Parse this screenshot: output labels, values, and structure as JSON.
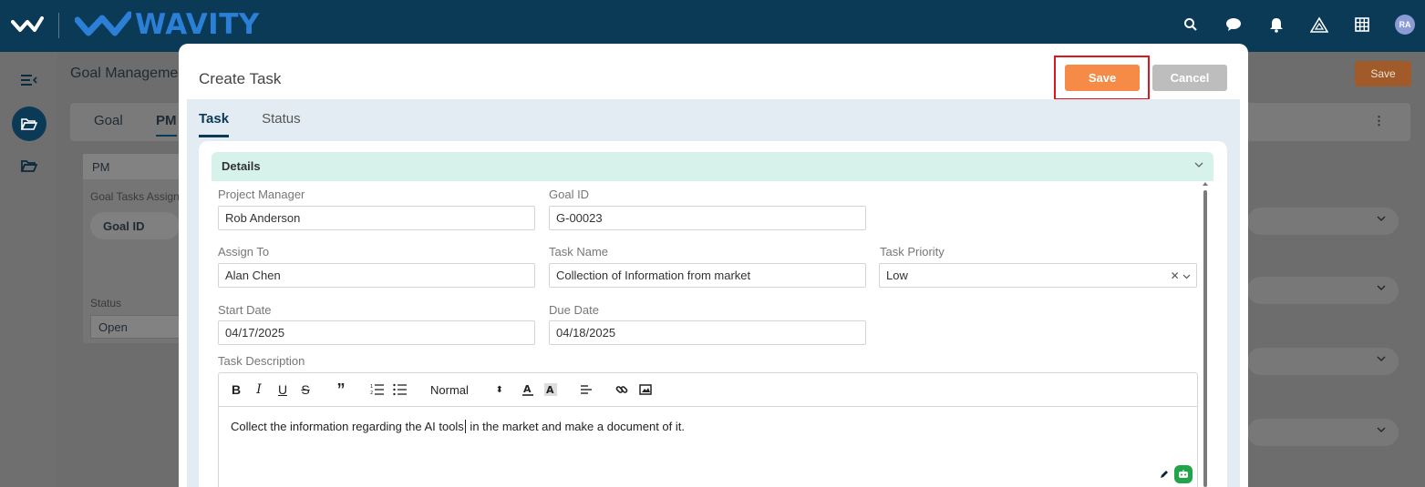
{
  "app": {
    "brand": "WAVITY",
    "avatar_initials": "RA",
    "top_icons": [
      "search-icon",
      "chat-icon",
      "bell-icon",
      "warning-icon",
      "grid-icon"
    ]
  },
  "background": {
    "breadcrumb": "Goal Managemen",
    "save_label": "Save",
    "tabs": [
      "Goal",
      "PM"
    ],
    "panel": {
      "header": "PM",
      "assign_label": "Goal Tasks Assign",
      "goal_id_pill": "Goal ID",
      "status_label": "Status",
      "status_value": "Open"
    }
  },
  "modal": {
    "title": "Create Task",
    "save_label": "Save",
    "cancel_label": "Cancel",
    "tabs": [
      {
        "label": "Task",
        "active": true
      },
      {
        "label": "Status",
        "active": false
      }
    ],
    "section_title": "Details",
    "fields": {
      "project_manager": {
        "label": "Project Manager",
        "value": "Rob Anderson"
      },
      "goal_id": {
        "label": "Goal ID",
        "value": "G-00023"
      },
      "assign_to": {
        "label": "Assign To",
        "value": "Alan Chen"
      },
      "task_name": {
        "label": "Task Name",
        "value": "Collection of Information from market"
      },
      "task_priority": {
        "label": "Task Priority",
        "value": "Low"
      },
      "start_date": {
        "label": "Start Date",
        "value": "04/17/2025"
      },
      "due_date": {
        "label": "Due Date",
        "value": "04/18/2025"
      },
      "task_description": {
        "label": "Task Description"
      }
    },
    "editor": {
      "heading_select": "Normal",
      "text_before_cursor": "Collect the information regarding the AI tools",
      "text_after_cursor": " in the market and make a document of it."
    }
  },
  "colors": {
    "topbar": "#0a3a56",
    "accent_orange": "#f58b47",
    "highlight_red": "#e0141b",
    "section_header": "#d6f2ea"
  }
}
